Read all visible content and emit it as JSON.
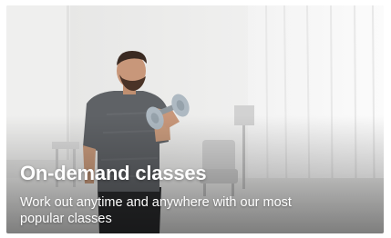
{
  "card": {
    "title": "On-demand classes",
    "subtitle": "Work out anytime and anywhere with our most popular classes",
    "image": "man-lifting-dumbbell-in-bright-living-room"
  },
  "colors": {
    "title_text": "#ffffff",
    "room_light": "#f1f1f1",
    "shirt": "#5f6266",
    "shorts": "#2a2b2d",
    "dumbbell": "#aeb9c2"
  }
}
